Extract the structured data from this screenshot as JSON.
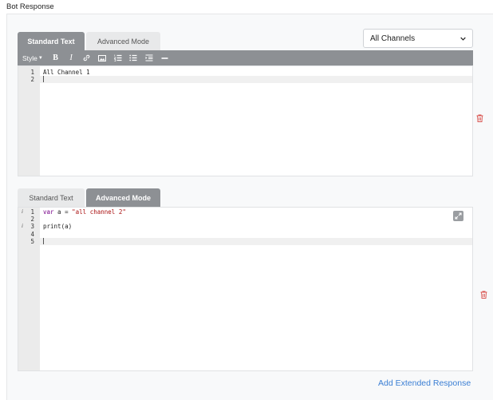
{
  "section": {
    "title": "Bot Response"
  },
  "response1": {
    "tabs": {
      "standard": "Standard Text",
      "advanced": "Advanced Mode"
    },
    "channel_select": {
      "value": "All Channels"
    },
    "toolbar": {
      "style_label": "Style"
    },
    "lines": [
      "1",
      "2"
    ],
    "code": {
      "line1": "All Channel 1"
    }
  },
  "response2": {
    "tabs": {
      "standard": "Standard Text",
      "advanced": "Advanced Mode"
    },
    "lines": [
      "1",
      "2",
      "3",
      "4",
      "5"
    ],
    "code": {
      "var_kw": "var",
      "var_mid": " a = ",
      "string": "\"all channel 2\"",
      "print": "print(a)"
    },
    "warn_marker": "i"
  },
  "footer": {
    "add_extended": "Add Extended Response"
  },
  "colors": {
    "accent_gray": "#8d9094",
    "link_blue": "#3b7fd4",
    "delete_red": "#d9534f"
  },
  "icons": [
    "bold-icon",
    "italic-icon",
    "link-icon",
    "image-icon",
    "ordered-list-icon",
    "unordered-list-icon",
    "indent-icon",
    "horizontal-rule-icon",
    "expand-icon",
    "trash-icon",
    "chevron-down-icon"
  ]
}
